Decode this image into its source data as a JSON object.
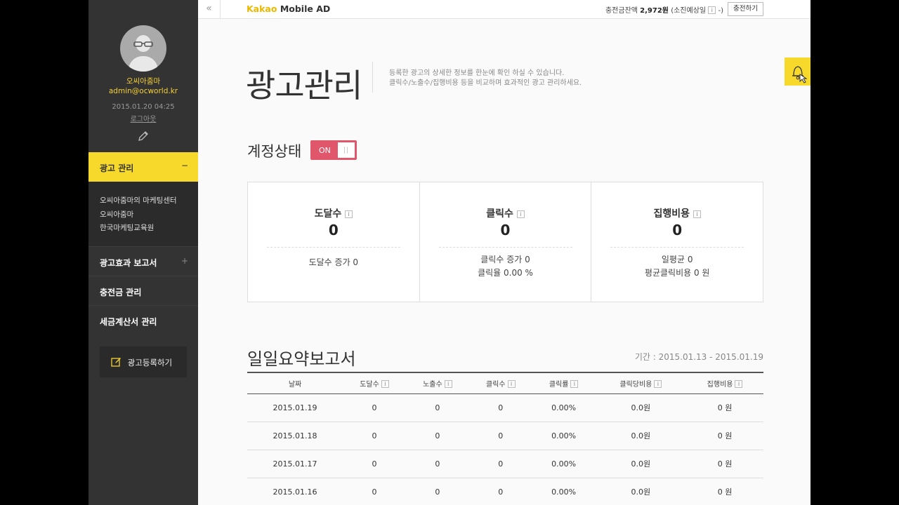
{
  "topbar": {
    "collapse_icon": "«",
    "brand_kakao": "Kakao",
    "brand_rest": " Mobile AD",
    "balance_label": "충전금잔액",
    "balance_value": "2,972원",
    "balance_suffix": "(소진예상일",
    "balance_info": "i",
    "balance_close": "-)",
    "charge_button": "충전하기"
  },
  "profile": {
    "name": "오씨아줌마",
    "email": "admin@ocworld.kr",
    "date": "2015.01.20 04:25",
    "logout": "로그아웃"
  },
  "menu": {
    "active": {
      "label": "광고 관리",
      "toggle": "−"
    },
    "sub_items": [
      "오씨아줌마의 마케팅센터",
      "오씨아줌마",
      "한국마케팅교육원"
    ],
    "items": [
      {
        "label": "광고효과 보고서",
        "toggle": "+"
      },
      {
        "label": "충전금 관리",
        "toggle": ""
      },
      {
        "label": "세금계산서 관리",
        "toggle": ""
      }
    ],
    "register_button": "광고등록하기"
  },
  "page": {
    "title": "광고관리",
    "desc_line1": "등록한 광고의 상세한 정보를 한눈에 확인 하실 수 있습니다.",
    "desc_line2": "클릭수/노출수/집행비용 등을 비교하며 효과적인 광고 관리하세요."
  },
  "account": {
    "label": "계정상태",
    "toggle": "ON"
  },
  "stats": [
    {
      "label": "도달수",
      "value": "0",
      "sub1": "도달수 증가  0",
      "sub2": ""
    },
    {
      "label": "클릭수",
      "value": "0",
      "sub1": "클릭수 증가  0",
      "sub2": "클릭율 0.00 %"
    },
    {
      "label": "집행비용",
      "value": "0",
      "sub1": "일평균  0",
      "sub2": "평균클릭비용  0 원"
    }
  ],
  "daily": {
    "title": "일일요약보고서",
    "period": "기간 : 2015.01.13 - 2015.01.19",
    "columns": [
      "날짜",
      "도달수",
      "노출수",
      "클릭수",
      "클릭률",
      "클릭당비용",
      "집행비용"
    ],
    "info_columns": [
      false,
      true,
      true,
      true,
      true,
      true,
      true
    ],
    "rows": [
      [
        "2015.01.19",
        "0",
        "0",
        "0",
        "0.00%",
        "0.0원",
        "0 원"
      ],
      [
        "2015.01.18",
        "0",
        "0",
        "0",
        "0.00%",
        "0.0원",
        "0 원"
      ],
      [
        "2015.01.17",
        "0",
        "0",
        "0",
        "0.00%",
        "0.0원",
        "0 원"
      ],
      [
        "2015.01.16",
        "0",
        "0",
        "0",
        "0.00%",
        "0.0원",
        "0 원"
      ]
    ]
  },
  "icons": {
    "bell": "bell-icon",
    "edit": "pencil-icon",
    "register": "edit-note-icon"
  },
  "colors": {
    "accent": "#f7d92c",
    "toggle_on": "#e0566a",
    "sidebar": "#333333"
  }
}
